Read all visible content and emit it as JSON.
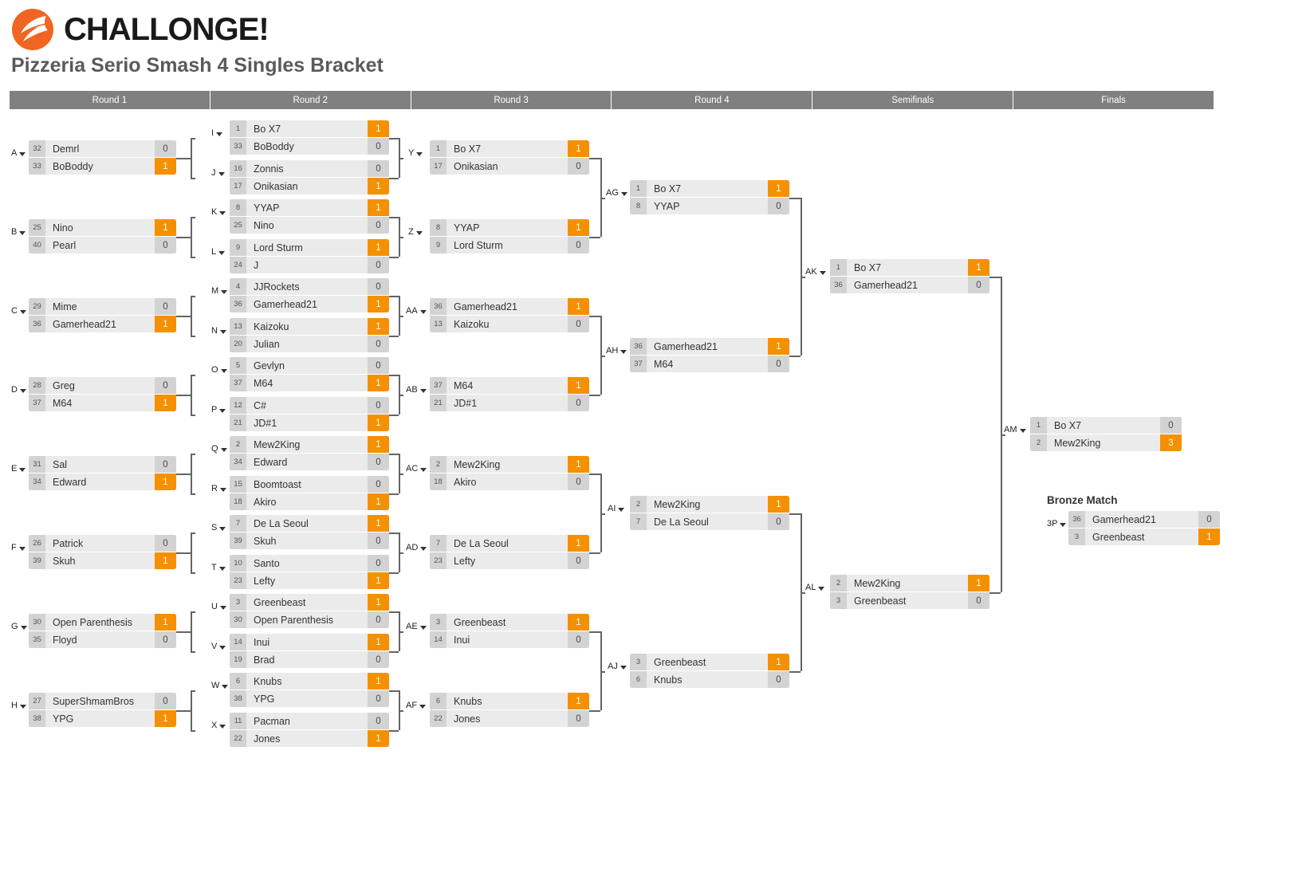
{
  "brand": {
    "name": "CHALLONGE!",
    "logo_color": "#F16522"
  },
  "page_title": "Pizzeria Serio Smash 4 Singles Bracket",
  "colors": {
    "win": "#f59000",
    "row": "#ebebeb",
    "seed": "#d3d3d3",
    "header": "#808080"
  },
  "rounds": [
    {
      "label": "Round 1"
    },
    {
      "label": "Round 2"
    },
    {
      "label": "Round 3"
    },
    {
      "label": "Round 4"
    },
    {
      "label": "Semifinals"
    },
    {
      "label": "Finals"
    }
  ],
  "bronze_title": "Bronze Match",
  "matches": {
    "A": {
      "label": "A",
      "p1": {
        "seed": "32",
        "name": "Demrl",
        "score": "0"
      },
      "p2": {
        "seed": "33",
        "name": "BoBoddy",
        "score": "1"
      },
      "winner": 2
    },
    "B": {
      "label": "B",
      "p1": {
        "seed": "25",
        "name": "Nino",
        "score": "1"
      },
      "p2": {
        "seed": "40",
        "name": "Pearl",
        "score": "0"
      },
      "winner": 1
    },
    "C": {
      "label": "C",
      "p1": {
        "seed": "29",
        "name": "Mime",
        "score": "0"
      },
      "p2": {
        "seed": "36",
        "name": "Gamerhead21",
        "score": "1"
      },
      "winner": 2
    },
    "D": {
      "label": "D",
      "p1": {
        "seed": "28",
        "name": "Greg",
        "score": "0"
      },
      "p2": {
        "seed": "37",
        "name": "M64",
        "score": "1"
      },
      "winner": 2
    },
    "E": {
      "label": "E",
      "p1": {
        "seed": "31",
        "name": "Sal",
        "score": "0"
      },
      "p2": {
        "seed": "34",
        "name": "Edward",
        "score": "1"
      },
      "winner": 2
    },
    "F": {
      "label": "F",
      "p1": {
        "seed": "26",
        "name": "Patrick",
        "score": "0"
      },
      "p2": {
        "seed": "39",
        "name": "Skuh",
        "score": "1"
      },
      "winner": 2
    },
    "G": {
      "label": "G",
      "p1": {
        "seed": "30",
        "name": "Open Parenthesis",
        "score": "1"
      },
      "p2": {
        "seed": "35",
        "name": "Floyd",
        "score": "0"
      },
      "winner": 1
    },
    "H": {
      "label": "H",
      "p1": {
        "seed": "27",
        "name": "SuperShmamBros",
        "score": "0"
      },
      "p2": {
        "seed": "38",
        "name": "YPG",
        "score": "1"
      },
      "winner": 2
    },
    "I": {
      "label": "I",
      "p1": {
        "seed": "1",
        "name": "Bo X7",
        "score": "1"
      },
      "p2": {
        "seed": "33",
        "name": "BoBoddy",
        "score": "0"
      },
      "winner": 1
    },
    "J": {
      "label": "J",
      "p1": {
        "seed": "16",
        "name": "Zonnis",
        "score": "0"
      },
      "p2": {
        "seed": "17",
        "name": "Onikasian",
        "score": "1"
      },
      "winner": 2
    },
    "K": {
      "label": "K",
      "p1": {
        "seed": "8",
        "name": "YYAP",
        "score": "1"
      },
      "p2": {
        "seed": "25",
        "name": "Nino",
        "score": "0"
      },
      "winner": 1
    },
    "L": {
      "label": "L",
      "p1": {
        "seed": "9",
        "name": "Lord Sturm",
        "score": "1"
      },
      "p2": {
        "seed": "24",
        "name": "J",
        "score": "0"
      },
      "winner": 1
    },
    "M": {
      "label": "M",
      "p1": {
        "seed": "4",
        "name": "JJRockets",
        "score": "0"
      },
      "p2": {
        "seed": "36",
        "name": "Gamerhead21",
        "score": "1"
      },
      "winner": 2
    },
    "N": {
      "label": "N",
      "p1": {
        "seed": "13",
        "name": "Kaizoku",
        "score": "1"
      },
      "p2": {
        "seed": "20",
        "name": "Julian",
        "score": "0"
      },
      "winner": 1
    },
    "O": {
      "label": "O",
      "p1": {
        "seed": "5",
        "name": "Gevlyn",
        "score": "0"
      },
      "p2": {
        "seed": "37",
        "name": "M64",
        "score": "1"
      },
      "winner": 2
    },
    "P": {
      "label": "P",
      "p1": {
        "seed": "12",
        "name": "C#",
        "score": "0"
      },
      "p2": {
        "seed": "21",
        "name": "JD#1",
        "score": "1"
      },
      "winner": 2
    },
    "Q": {
      "label": "Q",
      "p1": {
        "seed": "2",
        "name": "Mew2King",
        "score": "1"
      },
      "p2": {
        "seed": "34",
        "name": "Edward",
        "score": "0"
      },
      "winner": 1
    },
    "R": {
      "label": "R",
      "p1": {
        "seed": "15",
        "name": "Boomtoast",
        "score": "0"
      },
      "p2": {
        "seed": "18",
        "name": "Akiro",
        "score": "1"
      },
      "winner": 2
    },
    "S": {
      "label": "S",
      "p1": {
        "seed": "7",
        "name": "De La Seoul",
        "score": "1"
      },
      "p2": {
        "seed": "39",
        "name": "Skuh",
        "score": "0"
      },
      "winner": 1
    },
    "T": {
      "label": "T",
      "p1": {
        "seed": "10",
        "name": "Santo",
        "score": "0"
      },
      "p2": {
        "seed": "23",
        "name": "Lefty",
        "score": "1"
      },
      "winner": 2
    },
    "U": {
      "label": "U",
      "p1": {
        "seed": "3",
        "name": "Greenbeast",
        "score": "1"
      },
      "p2": {
        "seed": "30",
        "name": "Open Parenthesis",
        "score": "0"
      },
      "winner": 1
    },
    "V": {
      "label": "V",
      "p1": {
        "seed": "14",
        "name": "Inui",
        "score": "1"
      },
      "p2": {
        "seed": "19",
        "name": "Brad",
        "score": "0"
      },
      "winner": 1
    },
    "W": {
      "label": "W",
      "p1": {
        "seed": "6",
        "name": "Knubs",
        "score": "1"
      },
      "p2": {
        "seed": "38",
        "name": "YPG",
        "score": "0"
      },
      "winner": 1
    },
    "X": {
      "label": "X",
      "p1": {
        "seed": "11",
        "name": "Pacman",
        "score": "0"
      },
      "p2": {
        "seed": "22",
        "name": "Jones",
        "score": "1"
      },
      "winner": 2
    },
    "Y": {
      "label": "Y",
      "p1": {
        "seed": "1",
        "name": "Bo X7",
        "score": "1"
      },
      "p2": {
        "seed": "17",
        "name": "Onikasian",
        "score": "0"
      },
      "winner": 1
    },
    "Z": {
      "label": "Z",
      "p1": {
        "seed": "8",
        "name": "YYAP",
        "score": "1"
      },
      "p2": {
        "seed": "9",
        "name": "Lord Sturm",
        "score": "0"
      },
      "winner": 1
    },
    "AA": {
      "label": "AA",
      "p1": {
        "seed": "36",
        "name": "Gamerhead21",
        "score": "1"
      },
      "p2": {
        "seed": "13",
        "name": "Kaizoku",
        "score": "0"
      },
      "winner": 1
    },
    "AB": {
      "label": "AB",
      "p1": {
        "seed": "37",
        "name": "M64",
        "score": "1"
      },
      "p2": {
        "seed": "21",
        "name": "JD#1",
        "score": "0"
      },
      "winner": 1
    },
    "AC": {
      "label": "AC",
      "p1": {
        "seed": "2",
        "name": "Mew2King",
        "score": "1"
      },
      "p2": {
        "seed": "18",
        "name": "Akiro",
        "score": "0"
      },
      "winner": 1
    },
    "AD": {
      "label": "AD",
      "p1": {
        "seed": "7",
        "name": "De La Seoul",
        "score": "1"
      },
      "p2": {
        "seed": "23",
        "name": "Lefty",
        "score": "0"
      },
      "winner": 1
    },
    "AE": {
      "label": "AE",
      "p1": {
        "seed": "3",
        "name": "Greenbeast",
        "score": "1"
      },
      "p2": {
        "seed": "14",
        "name": "Inui",
        "score": "0"
      },
      "winner": 1
    },
    "AF": {
      "label": "AF",
      "p1": {
        "seed": "6",
        "name": "Knubs",
        "score": "1"
      },
      "p2": {
        "seed": "22",
        "name": "Jones",
        "score": "0"
      },
      "winner": 1
    },
    "AG": {
      "label": "AG",
      "p1": {
        "seed": "1",
        "name": "Bo X7",
        "score": "1"
      },
      "p2": {
        "seed": "8",
        "name": "YYAP",
        "score": "0"
      },
      "winner": 1
    },
    "AH": {
      "label": "AH",
      "p1": {
        "seed": "36",
        "name": "Gamerhead21",
        "score": "1"
      },
      "p2": {
        "seed": "37",
        "name": "M64",
        "score": "0"
      },
      "winner": 1
    },
    "AI": {
      "label": "AI",
      "p1": {
        "seed": "2",
        "name": "Mew2King",
        "score": "1"
      },
      "p2": {
        "seed": "7",
        "name": "De La Seoul",
        "score": "0"
      },
      "winner": 1
    },
    "AJ": {
      "label": "AJ",
      "p1": {
        "seed": "3",
        "name": "Greenbeast",
        "score": "1"
      },
      "p2": {
        "seed": "6",
        "name": "Knubs",
        "score": "0"
      },
      "winner": 1
    },
    "AK": {
      "label": "AK",
      "p1": {
        "seed": "1",
        "name": "Bo X7",
        "score": "1"
      },
      "p2": {
        "seed": "36",
        "name": "Gamerhead21",
        "score": "0"
      },
      "winner": 1
    },
    "AL": {
      "label": "AL",
      "p1": {
        "seed": "2",
        "name": "Mew2King",
        "score": "1"
      },
      "p2": {
        "seed": "3",
        "name": "Greenbeast",
        "score": "0"
      },
      "winner": 1
    },
    "AM": {
      "label": "AM",
      "p1": {
        "seed": "1",
        "name": "Bo X7",
        "score": "0"
      },
      "p2": {
        "seed": "2",
        "name": "Mew2King",
        "score": "3"
      },
      "winner": 2
    },
    "3P": {
      "label": "3P",
      "p1": {
        "seed": "36",
        "name": "Gamerhead21",
        "score": "0"
      },
      "p2": {
        "seed": "3",
        "name": "Greenbeast",
        "score": "1"
      },
      "winner": 2
    }
  }
}
